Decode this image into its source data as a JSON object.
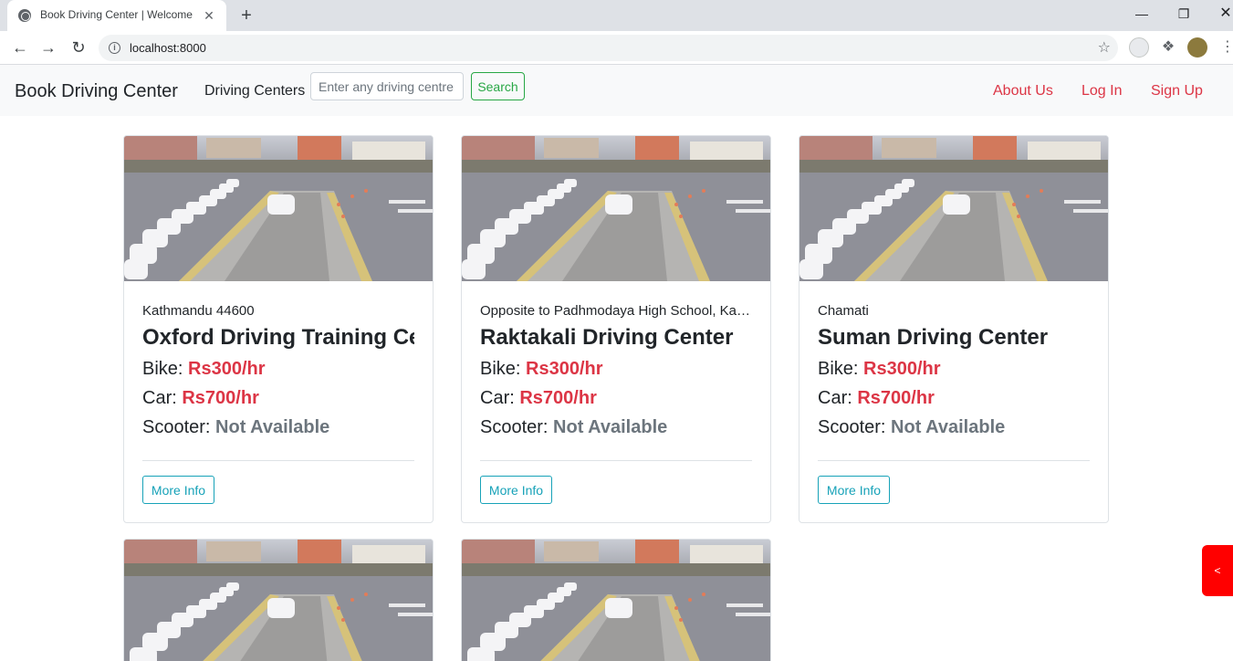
{
  "browser": {
    "tab_title": "Book Driving Center | Welcome",
    "url": "localhost:8000",
    "new_tab_glyph": "+",
    "close_glyph": "✕"
  },
  "navbar": {
    "brand": "Book Driving Center",
    "centers_link": "Driving Centers",
    "search_placeholder": "Enter any driving centre",
    "search_button": "Search",
    "about": "About Us",
    "login": "Log In",
    "signup": "Sign Up"
  },
  "cards": [
    {
      "address": "Kathmandu 44600",
      "name": "Oxford Driving Training Center",
      "bike_label": "Bike:",
      "bike_price": "Rs300/hr",
      "car_label": "Car:",
      "car_price": "Rs700/hr",
      "scooter_label": "Scooter:",
      "scooter_price": "Not Available",
      "button": "More Info"
    },
    {
      "address": "Opposite to Padhmodaya High School, Kathmandu",
      "name": "Raktakali Driving Center",
      "bike_label": "Bike:",
      "bike_price": "Rs300/hr",
      "car_label": "Car:",
      "car_price": "Rs700/hr",
      "scooter_label": "Scooter:",
      "scooter_price": "Not Available",
      "button": "More Info"
    },
    {
      "address": "Chamati",
      "name": "Suman Driving Center",
      "bike_label": "Bike:",
      "bike_price": "Rs300/hr",
      "car_label": "Car:",
      "car_price": "Rs700/hr",
      "scooter_label": "Scooter:",
      "scooter_price": "Not Available",
      "button": "More Info"
    }
  ],
  "side_tab": "<",
  "colors": {
    "danger": "#dc3545",
    "success": "#28a745",
    "info": "#17a2b8",
    "muted": "#6c757d"
  }
}
